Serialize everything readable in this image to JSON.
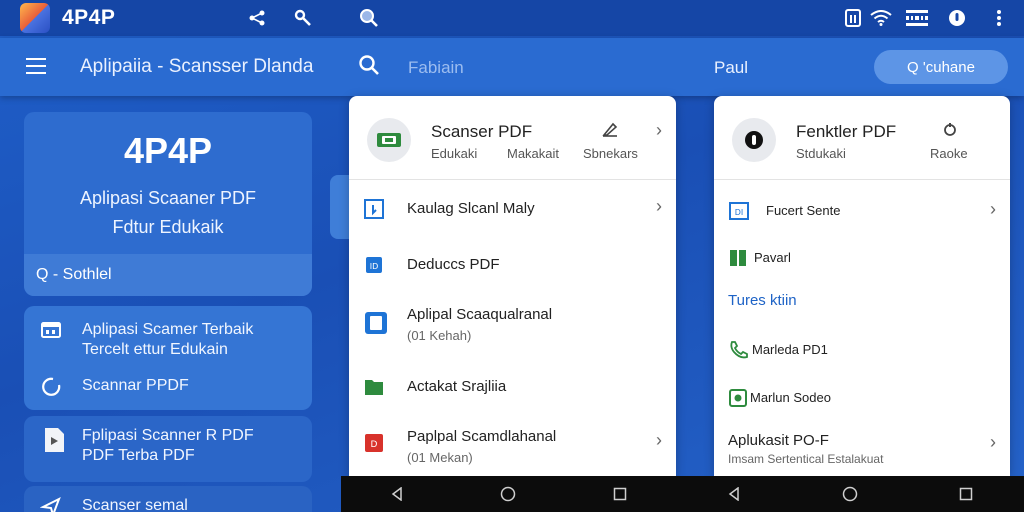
{
  "status_bar": {
    "app_name": "4P4P",
    "icons": [
      "share-icon",
      "key-icon",
      "magnifier-icon",
      "sim-icon",
      "wifi-icon",
      "barcode-icon",
      "alarm-icon",
      "overflow-icon"
    ]
  },
  "app_bar": {
    "title": "Aplipaiia - Scansser Dlanda",
    "search_placeholder": "Fabiain",
    "user_label": "Paul",
    "search_button": "Q 'cuhane"
  },
  "hero": {
    "title": "4P4P",
    "line1": "Aplipasi Scaaner PDF",
    "line2": "Fdtur Edukaik",
    "search_row": "Q  - Sothlel"
  },
  "left_menu": [
    {
      "label_line1": "Aplipasi Scamer Terbaik",
      "label_line2": "Tercelt ettur Edukain",
      "icon": "screen-icon"
    },
    {
      "label_line1": "Scannar PPDF",
      "label_line2": "",
      "icon": "circle-icon"
    },
    {
      "label_line1": "Fplipasi Scanner R PDF",
      "label_line2": "PDF Terba PDF",
      "icon": "document-icon"
    },
    {
      "label_line1": "Scanser semal",
      "label_line2": "",
      "icon": "send-icon"
    }
  ],
  "panel1": {
    "title": "Scanser PDF",
    "sub_left": "Edukaki",
    "sub_mid": "Makakait",
    "action_label": "Sbnekars",
    "rows": [
      {
        "label": "Kaulag Slcanl Maly",
        "sub": ""
      },
      {
        "label": "Deduccs PDF",
        "sub": ""
      },
      {
        "label": "Aplipal Scaaqualranal",
        "sub": "(01 Kehah)"
      },
      {
        "label": "Actakat Srajliia",
        "sub": ""
      },
      {
        "label": "Paplpal Scamdlahanal",
        "sub": "(01 Mekan)"
      }
    ]
  },
  "panel2": {
    "title": "Fenktler PDF",
    "sub_left": "Stdukaki",
    "action_label": "Raoke",
    "rows": [
      {
        "label": "Fucert Sente",
        "sub": ""
      },
      {
        "label": "Pavarl",
        "sub": ""
      },
      {
        "label": "Tures ktiin",
        "sub": ""
      },
      {
        "label": "Marleda PD1",
        "sub": ""
      },
      {
        "label": "Marlun Sodeo",
        "sub": ""
      },
      {
        "label": "Aplukasit PO-F",
        "sub": "Imsam Sertentical Estalakuat"
      }
    ]
  },
  "colors": {
    "primary": "#2a6bd1",
    "status_bar": "#1546a6",
    "accent_button": "#5d95e6",
    "green_icon": "#2e8b3e",
    "red_icon": "#d8322b",
    "blue_icon": "#1e74d6"
  }
}
